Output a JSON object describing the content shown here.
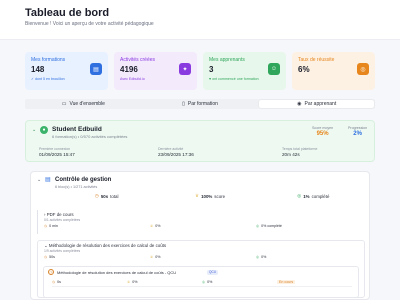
{
  "header": {
    "title": "Tableau de bord",
    "subtitle": "Bienvenue ! Voici un aperçu de votre activité pédagogique"
  },
  "stats": [
    {
      "label": "Mes formations",
      "value": "148",
      "meta": "✓ dont 5 en brouillon",
      "bg": "#e8f1ff",
      "accent": "#2f6fe0",
      "icon": "book-icon"
    },
    {
      "label": "Activités créées",
      "value": "4196",
      "meta": "Avec Edbuild.io",
      "bg": "#f3eafc",
      "accent": "#8a3be0",
      "icon": "sparkle-icon"
    },
    {
      "label": "Mes apprenants",
      "value": "3",
      "meta": "♥ ont commencé une formation",
      "bg": "#e8f7ec",
      "accent": "#2fa65b",
      "icon": "user-icon"
    },
    {
      "label": "Taux de réussite",
      "value": "6%",
      "meta": "",
      "bg": "#fdf1e4",
      "accent": "#e6861d",
      "icon": "target-icon"
    }
  ],
  "tabs": [
    {
      "label": "Vue d'ensemble",
      "glyph": "▭",
      "active": false
    },
    {
      "label": "Par formation",
      "glyph": "▯",
      "active": false
    },
    {
      "label": "Par apprenant",
      "glyph": "◉",
      "active": true
    }
  ],
  "learner": {
    "name": "Student Edbuild",
    "summary": "6 formation(s) • 0/570 activités complétées",
    "score_label": "Score moyen",
    "score_value": "95%",
    "progress_label": "Progression",
    "progress_value": "2%",
    "first_label": "Première connexion",
    "first_value": "01/09/2025 15:47",
    "last_label": "Dernière activité",
    "last_value": "23/09/2025 17:36",
    "time_label": "Temps total plateforme",
    "time_value": "20m 42s"
  },
  "course": {
    "title": "Contrôle de gestion",
    "summary": "6 bloc(s) • 1/271 activités",
    "stats": [
      {
        "glyph": "◷",
        "value": "50s",
        "label": "total"
      },
      {
        "glyph": "♕",
        "value": "100%",
        "label": "score"
      },
      {
        "glyph": "◎",
        "value": "1%",
        "label": "complété"
      }
    ],
    "sections": [
      {
        "title": "PDF de cours",
        "sub": "0/1 activités complétées",
        "row": [
          "0 min",
          "0%",
          "0% complété"
        ]
      },
      {
        "title": "Méthodologie de résolution des exercices de calcul de coûts",
        "sub": "1/9 activités complétées",
        "row": [
          "50s",
          "0%",
          "0%"
        ]
      }
    ],
    "quiz": {
      "title": "Méthodologie de résolution des exercices de calcul de coûts - QCU",
      "tag": "QCU",
      "row": [
        "0s",
        "0%",
        "0%",
        "En cours"
      ]
    }
  }
}
